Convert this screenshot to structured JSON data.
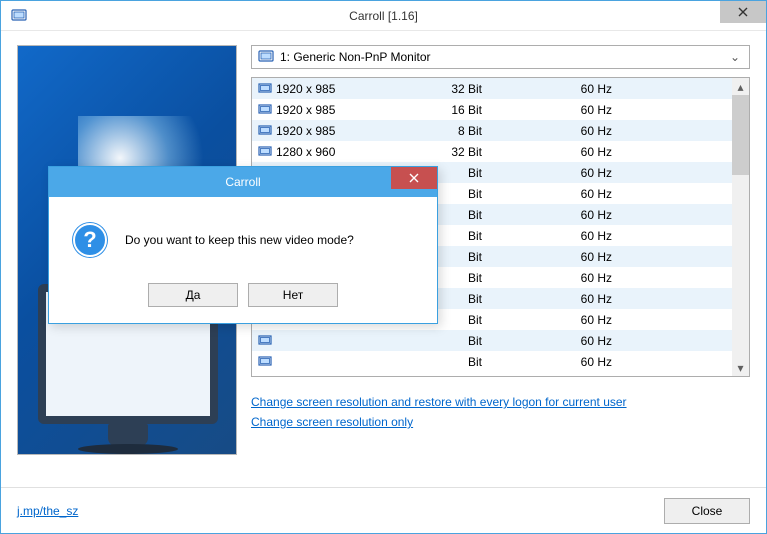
{
  "window": {
    "title": "Carroll [1.16]"
  },
  "monitor_select": {
    "label": "1: Generic Non-PnP Monitor"
  },
  "resolutions": [
    {
      "res": "1920 x 985",
      "bit": "32 Bit",
      "hz": "60 Hz"
    },
    {
      "res": "1920 x 985",
      "bit": "16 Bit",
      "hz": "60 Hz"
    },
    {
      "res": "1920 x 985",
      "bit": "8 Bit",
      "hz": "60 Hz"
    },
    {
      "res": "1280 x 960",
      "bit": "32 Bit",
      "hz": "60 Hz"
    },
    {
      "res": "",
      "bit": "Bit",
      "hz": "60 Hz"
    },
    {
      "res": "",
      "bit": "Bit",
      "hz": "60 Hz"
    },
    {
      "res": "",
      "bit": "Bit",
      "hz": "60 Hz"
    },
    {
      "res": "",
      "bit": "Bit",
      "hz": "60 Hz"
    },
    {
      "res": "",
      "bit": "Bit",
      "hz": "60 Hz"
    },
    {
      "res": "",
      "bit": "Bit",
      "hz": "60 Hz"
    },
    {
      "res": "",
      "bit": "Bit",
      "hz": "60 Hz"
    },
    {
      "res": "",
      "bit": "Bit",
      "hz": "60 Hz"
    },
    {
      "res": "",
      "bit": "Bit",
      "hz": "60 Hz"
    },
    {
      "res": "",
      "bit": "Bit",
      "hz": "60 Hz"
    }
  ],
  "links": {
    "change_per_user": "Change screen resolution and restore with every logon for current user",
    "change_only": "Change screen resolution only"
  },
  "footer": {
    "url": "j.mp/the_sz",
    "close": "Close"
  },
  "dialog": {
    "title": "Carroll",
    "message": "Do you want to keep this new video mode?",
    "yes": "Да",
    "no": "Нет"
  }
}
